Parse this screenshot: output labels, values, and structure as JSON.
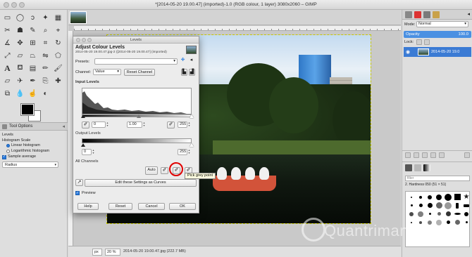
{
  "window": {
    "title": "*[2014-05-20 19.00.47] (imported)-1.0 (RGB colour, 1 layer) 3080x2060 – GIMP"
  },
  "toolbox": {
    "tools": [
      "rect-select",
      "ellipse-select",
      "free-select",
      "fuzzy-select",
      "select-by-color",
      "scissors",
      "foreground-select",
      "paths",
      "color-picker",
      "zoom",
      "measure",
      "move",
      "align",
      "crop",
      "rotate",
      "scale",
      "shear",
      "perspective",
      "flip",
      "cage",
      "text",
      "bucket-fill",
      "blend",
      "pencil",
      "paintbrush",
      "eraser",
      "airbrush",
      "ink",
      "clone",
      "heal",
      "perspective-clone",
      "blur",
      "smudge",
      "dodge-burn"
    ],
    "options_tab": "Tool Options",
    "levels_title": "Levels",
    "histogram_scale_label": "Histogram Scale",
    "linear_label": "Linear histogram",
    "log_label": "Logarithmic histogram",
    "sample_average_label": "Sample average",
    "radius_value": "Radius"
  },
  "dialog": {
    "window_title": "Levels",
    "heading": "Adjust Colour Levels",
    "subheading": "2014-05-20 19.00.47.jpg-2 ([2014-05-20 19.00.47] (imported)",
    "presets_label": "Presets:",
    "channel_label": "Channel:",
    "channel_value": "Value",
    "reset_channel": "Reset Channel",
    "input_levels": "Input Levels",
    "input_low": "0",
    "input_gamma": "1.00",
    "input_high": "255",
    "output_levels": "Output Levels",
    "output_low": "0",
    "output_high": "255",
    "all_channels": "All Channels",
    "auto_label": "Auto",
    "edit_curves": "Edit these Settings as Curves",
    "preview_label": "Preview",
    "help_label": "Help",
    "reset_label": "Reset",
    "cancel_label": "Cancel",
    "ok_label": "OK",
    "tooltip": "Pick grey point"
  },
  "statusbar": {
    "unit": "px",
    "zoom": "20 %",
    "info": "2014-05-20 19.00.47.jpg (222.7 MB)"
  },
  "rightdock": {
    "mode_label": "Mode:",
    "mode_value": "Normal",
    "opacity_label": "Opacity",
    "opacity_value": "100.0",
    "lock_label": "Lock:",
    "layer_name": "2014-05-20 19.0",
    "brush_filter": "filter",
    "brush_name": "2. Hardness 050 (51 × 51)"
  },
  "watermark": {
    "text": "Quantrimang"
  }
}
